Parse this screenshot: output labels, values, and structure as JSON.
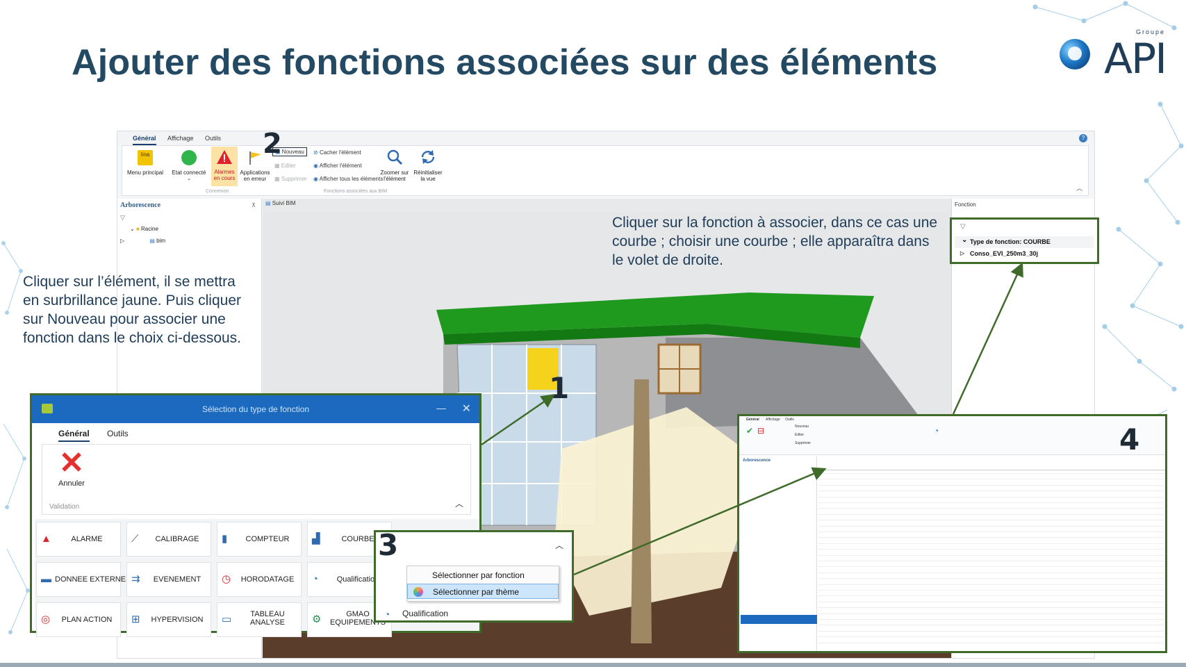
{
  "slide": {
    "title": "Ajouter des fonctions associées sur des éléments",
    "logo_groupe": "Groupe",
    "logo_name": "API"
  },
  "callouts": {
    "left": "Cliquer sur l’élément, il se mettra en surbrillance jaune. Puis cliquer sur Nouveau pour associer une fonction dans le choix ci-dessous.",
    "right": "Cliquer sur la fonction à associer, dans ce cas une courbe ; choisir une courbe ; elle apparaîtra dans le volet de droite."
  },
  "steps": [
    "1",
    "2",
    "3",
    "4"
  ],
  "app": {
    "tabs": [
      "Général",
      "Affichage",
      "Outils"
    ],
    "ribbon": {
      "menu_principal": "Menu principal",
      "lina_badge": "lina",
      "etat_connecte": "Etat connecté",
      "alarmes": "Alarmes en cours",
      "applications": "Applications en erreur",
      "nouveau": "Nouveau",
      "editer": "Editer",
      "supprimer": "Supprimer",
      "cacher": "Cacher l'élément",
      "afficher": "Afficher l'élément",
      "afficher_tous": "Afficher tous les éléments",
      "zoomer": "Zoomer sur l'élément",
      "reinitialiser": "Réinitialiser la vue",
      "group_connexion": "Connexion",
      "group_fonctions": "Fonctions associées aux BIM"
    },
    "tree": {
      "header": "Arborescence",
      "root": "Racine",
      "child": "bim"
    },
    "viewer_tab": "Suivi BIM",
    "fn_panel": {
      "header": "Fonction",
      "type_label": "Type de fonction: COURBE",
      "item": "Conso_EVI_250m3_30j"
    }
  },
  "dialog": {
    "title": "Sélection du type de fonction",
    "tabs": [
      "Général",
      "Outils"
    ],
    "annuler": "Annuler",
    "group": "Validation",
    "buttons": [
      {
        "label": "ALARME",
        "icon": "alarm-icon",
        "color": "#d9262b"
      },
      {
        "label": "CALIBRAGE",
        "icon": "calibration-icon",
        "color": "#555555"
      },
      {
        "label": "COMPTEUR",
        "icon": "counter-icon",
        "color": "#2f6bb3"
      },
      {
        "label": "COURBE",
        "icon": "curve-icon",
        "color": "#2f6bb3"
      },
      {
        "label": "DONNEE EXTERNE",
        "icon": "external-data-icon",
        "color": "#2f6bb3"
      },
      {
        "label": "EVENEMENT",
        "icon": "event-icon",
        "color": "#2f6bb3"
      },
      {
        "label": "HORODATAGE",
        "icon": "timestamp-icon",
        "color": "#d9262b"
      },
      {
        "label": "Qualification",
        "icon": "qualification-icon",
        "color": "#3876c4"
      },
      {
        "label": "PLAN ACTION",
        "icon": "action-plan-icon",
        "color": "#d9262b"
      },
      {
        "label": "HYPERVISION",
        "icon": "hypervision-icon",
        "color": "#2f6bb3"
      },
      {
        "label": "TABLEAU ANALYSE",
        "icon": "analysis-table-icon",
        "color": "#2f6bb3"
      },
      {
        "label": "GMAO EQUIPEMENTS",
        "icon": "gmao-icon",
        "color": "#2e8b57"
      }
    ]
  },
  "dropdown": {
    "items": [
      "Sélectionner par fonction",
      "Sélectionner par thème"
    ],
    "below": "Qualification"
  },
  "colors": {
    "title": "#244a63",
    "highlight_border": "#3f6b2a",
    "dialog_bar": "#1b6ac0",
    "roof": "#1f9a1f",
    "selected_element": "#f5d21c"
  }
}
